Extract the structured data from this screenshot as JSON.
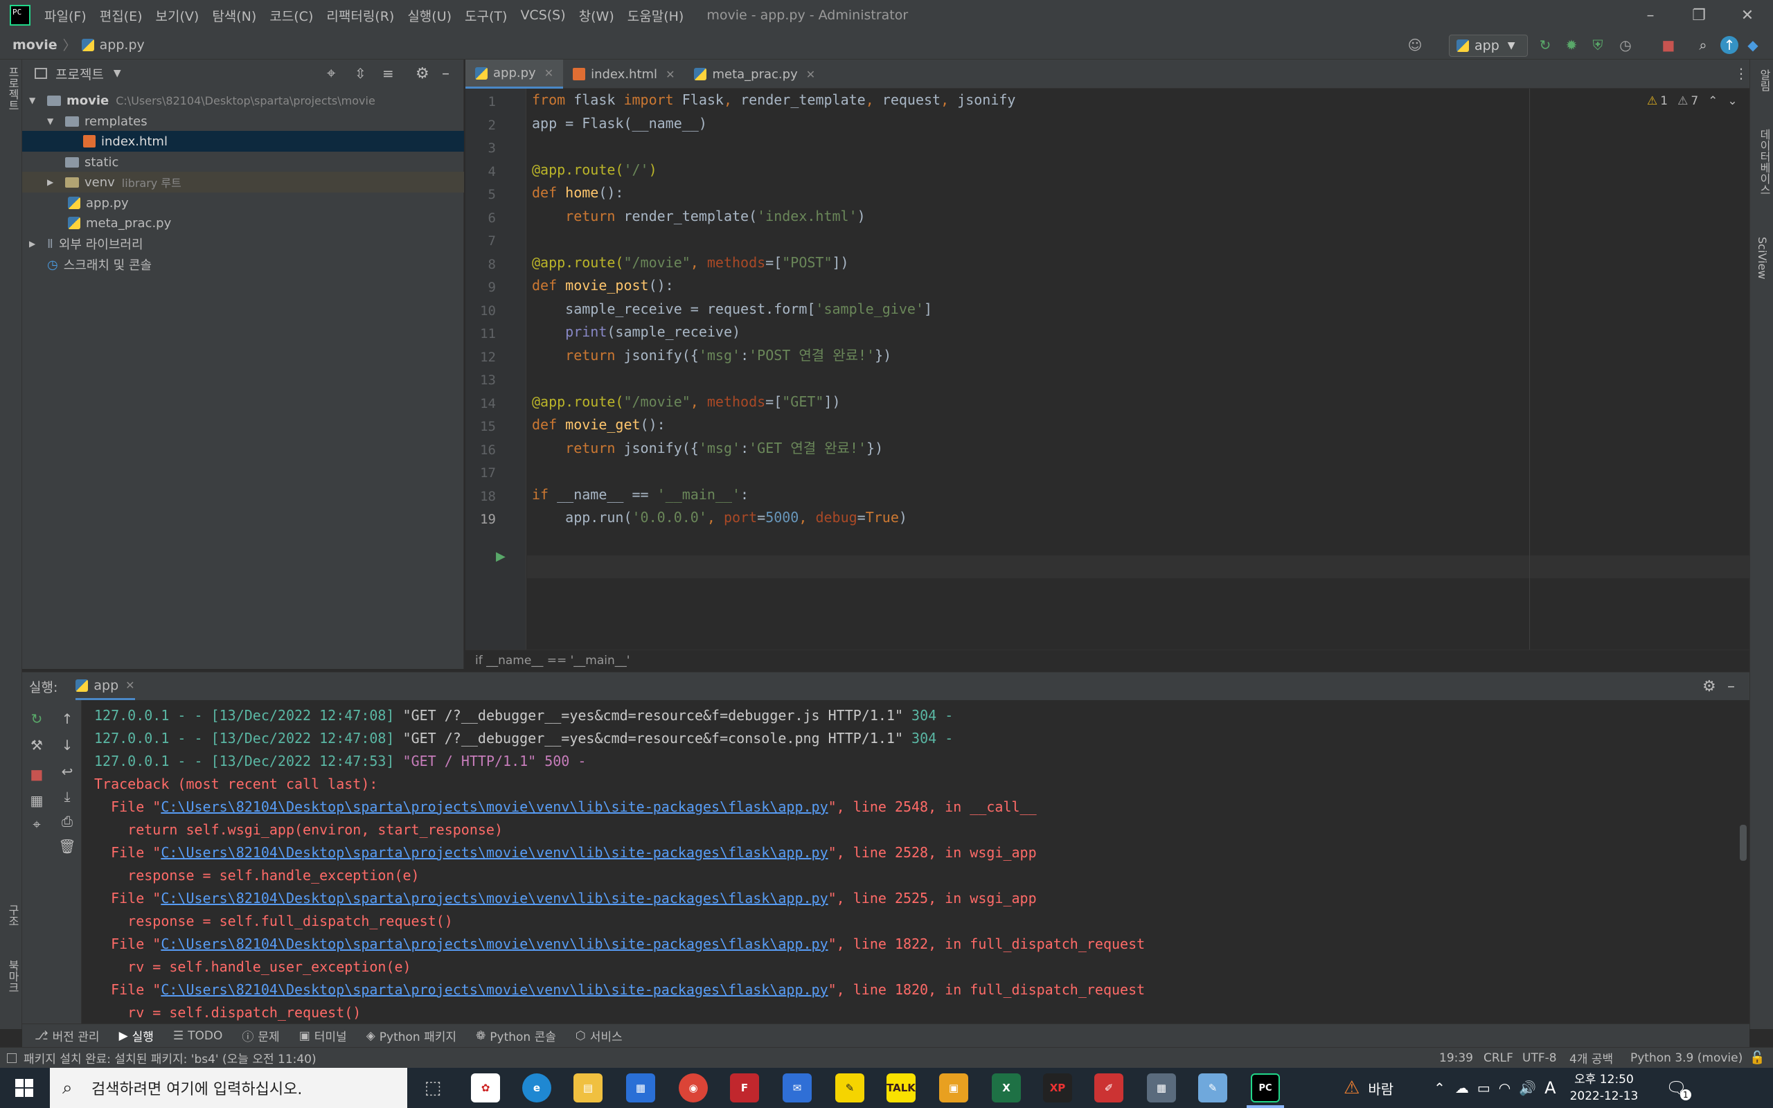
{
  "menubar": {
    "items": [
      "파일(F)",
      "편집(E)",
      "보기(V)",
      "탐색(N)",
      "코드(C)",
      "리팩터링(R)",
      "실행(U)",
      "도구(T)",
      "VCS(S)",
      "창(W)",
      "도움말(H)"
    ],
    "window_title": "movie - app.py - Administrator"
  },
  "navbar": {
    "project": "movie",
    "file": "app.py",
    "run_config": "app"
  },
  "project": {
    "header": "프로젝트",
    "root_name": "movie",
    "root_path": "C:\\Users\\82104\\Desktop\\sparta\\projects\\movie",
    "templates": "remplates",
    "index": "index.html",
    "static": "static",
    "venv": "venv",
    "venv_note": "library 루트",
    "app": "app.py",
    "meta": "meta_prac.py",
    "ext_libs": "외부 라이브러리",
    "scratch": "스크래치 및 콘솔"
  },
  "tabs": [
    {
      "label": "app.py"
    },
    {
      "label": "index.html"
    },
    {
      "label": "meta_prac.py"
    }
  ],
  "inspections": {
    "warn": "1",
    "weak": "7"
  },
  "code": [
    [
      [
        "kw",
        "from "
      ],
      [
        "",
        "flask "
      ],
      [
        "kw",
        "import "
      ],
      [
        "",
        "Flask"
      ],
      [
        "kw",
        ", "
      ],
      [
        "",
        "render_template"
      ],
      [
        "kw",
        ", "
      ],
      [
        "",
        "request"
      ],
      [
        "kw",
        ", "
      ],
      [
        "",
        "jsonify"
      ]
    ],
    [
      [
        "",
        "app = Flask(__name__)"
      ]
    ],
    [],
    [
      [
        "dec",
        "@app.route("
      ],
      [
        "str",
        "'/'"
      ],
      [
        "dec",
        ")"
      ]
    ],
    [
      [
        "kw",
        "def "
      ],
      [
        "fn",
        "home"
      ],
      [
        "",
        "():"
      ]
    ],
    [
      [
        "",
        "    "
      ],
      [
        "kw",
        "return "
      ],
      [
        "",
        "render_template("
      ],
      [
        "str",
        "'index.html'"
      ],
      [
        "",
        ")"
      ]
    ],
    [],
    [
      [
        "dec",
        "@app.route("
      ],
      [
        "str",
        "\"/movie\""
      ],
      [
        "kw",
        ", "
      ],
      [
        "pm",
        "methods"
      ],
      [
        "",
        "=["
      ],
      [
        "str",
        "\"POST\""
      ],
      [
        "",
        "])"
      ]
    ],
    [
      [
        "kw",
        "def "
      ],
      [
        "fn",
        "movie_post"
      ],
      [
        "",
        "():"
      ]
    ],
    [
      [
        "",
        "    sample_receive = request.form["
      ],
      [
        "str",
        "'sample_give'"
      ],
      [
        "",
        "]"
      ]
    ],
    [
      [
        "",
        "    "
      ],
      [
        "bi",
        "print"
      ],
      [
        "",
        "(sample_receive)"
      ]
    ],
    [
      [
        "",
        "    "
      ],
      [
        "kw",
        "return "
      ],
      [
        "",
        "jsonify({"
      ],
      [
        "str",
        "'msg'"
      ],
      [
        "",
        ":"
      ],
      [
        "str",
        "'POST 연결 완료!'"
      ],
      [
        "",
        "})"
      ]
    ],
    [],
    [
      [
        "dec",
        "@app.route("
      ],
      [
        "str",
        "\"/movie\""
      ],
      [
        "kw",
        ", "
      ],
      [
        "pm",
        "methods"
      ],
      [
        "",
        "=["
      ],
      [
        "str",
        "\"GET\""
      ],
      [
        "",
        "])"
      ]
    ],
    [
      [
        "kw",
        "def "
      ],
      [
        "fn",
        "movie_get"
      ],
      [
        "",
        "():"
      ]
    ],
    [
      [
        "",
        "    "
      ],
      [
        "kw",
        "return "
      ],
      [
        "",
        "jsonify({"
      ],
      [
        "str",
        "'msg'"
      ],
      [
        "",
        ":"
      ],
      [
        "str",
        "'GET 연결 완료!'"
      ],
      [
        "",
        "})"
      ]
    ],
    [],
    [
      [
        "kw",
        "if "
      ],
      [
        "",
        "__name__ == "
      ],
      [
        "str",
        "'__main__'"
      ],
      [
        "",
        ":"
      ]
    ],
    [
      [
        "",
        "    app.run("
      ],
      [
        "str",
        "'0.0.0.0'"
      ],
      [
        "kw",
        ", "
      ],
      [
        "pm",
        "port"
      ],
      [
        "",
        "="
      ],
      [
        "num",
        "5000"
      ],
      [
        "kw",
        ", "
      ],
      [
        "pm",
        "debug"
      ],
      [
        "",
        "="
      ],
      [
        "kw",
        "True"
      ],
      [
        "",
        ")"
      ]
    ]
  ],
  "editor_breadcrumb": "if __name__ == '__main__'",
  "run": {
    "label": "실행:",
    "tab": "app"
  },
  "console": [
    [
      [
        "grn",
        "127.0.0.1 - - [13/Dec/2022 12:47:08] "
      ],
      [
        "yel",
        "\"GET /?__debugger__=yes&cmd=resource&f=debugger.js HTTP/1.1\""
      ],
      [
        "grn",
        " 304 -"
      ]
    ],
    [
      [
        "grn",
        "127.0.0.1 - - [13/Dec/2022 12:47:08] "
      ],
      [
        "yel",
        "\"GET /?__debugger__=yes&cmd=resource&f=console.png HTTP/1.1\""
      ],
      [
        "grn",
        " 304 -"
      ]
    ],
    [
      [
        "grn",
        "127.0.0.1 - - [13/Dec/2022 12:47:53] "
      ],
      [
        "mag",
        "\"GET / HTTP/1.1\""
      ],
      [
        "mag",
        " 500 -"
      ]
    ],
    [
      [
        "err",
        "Traceback (most recent call last):"
      ]
    ],
    [
      [
        "err",
        "  File \""
      ],
      [
        "lnk",
        "C:\\Users\\82104\\Desktop\\sparta\\projects\\movie\\venv\\lib\\site-packages\\flask\\app.py"
      ],
      [
        "err",
        "\", line 2548, in __call__"
      ]
    ],
    [
      [
        "err",
        "    return self.wsgi_app(environ, start_response)"
      ]
    ],
    [
      [
        "err",
        "  File \""
      ],
      [
        "lnk",
        "C:\\Users\\82104\\Desktop\\sparta\\projects\\movie\\venv\\lib\\site-packages\\flask\\app.py"
      ],
      [
        "err",
        "\", line 2528, in wsgi_app"
      ]
    ],
    [
      [
        "err",
        "    response = self.handle_exception(e)"
      ]
    ],
    [
      [
        "err",
        "  File \""
      ],
      [
        "lnk",
        "C:\\Users\\82104\\Desktop\\sparta\\projects\\movie\\venv\\lib\\site-packages\\flask\\app.py"
      ],
      [
        "err",
        "\", line 2525, in wsgi_app"
      ]
    ],
    [
      [
        "err",
        "    response = self.full_dispatch_request()"
      ]
    ],
    [
      [
        "err",
        "  File \""
      ],
      [
        "lnk",
        "C:\\Users\\82104\\Desktop\\sparta\\projects\\movie\\venv\\lib\\site-packages\\flask\\app.py"
      ],
      [
        "err",
        "\", line 1822, in full_dispatch_request"
      ]
    ],
    [
      [
        "err",
        "    rv = self.handle_user_exception(e)"
      ]
    ],
    [
      [
        "err",
        "  File \""
      ],
      [
        "lnk",
        "C:\\Users\\82104\\Desktop\\sparta\\projects\\movie\\venv\\lib\\site-packages\\flask\\app.py"
      ],
      [
        "err",
        "\", line 1820, in full_dispatch_request"
      ]
    ],
    [
      [
        "err",
        "    rv = self.dispatch_request()"
      ]
    ]
  ],
  "bottom_tabs": [
    {
      "icon": "branch-icon",
      "label": "버전 관리"
    },
    {
      "icon": "run-icon",
      "label": "실행"
    },
    {
      "icon": "list-icon",
      "label": "TODO"
    },
    {
      "icon": "info-icon",
      "label": "문제"
    },
    {
      "icon": "terminal-icon",
      "label": "터미널"
    },
    {
      "icon": "layers-icon",
      "label": "Python 패키지"
    },
    {
      "icon": "python-console-icon",
      "label": "Python 콘솔"
    },
    {
      "icon": "services-icon",
      "label": "서비스"
    }
  ],
  "status": {
    "message": "패키지 설치 완료: 설치된 패키지: 'bs4' (오늘 오전 11:40)",
    "position": "19:39",
    "eol": "CRLF",
    "encoding": "UTF-8",
    "indent": "4개 공백",
    "interpreter": "Python 3.9 (movie)"
  },
  "side_labels": {
    "left_top": "프로젝트",
    "left_mid": "구조",
    "left_bottom": "북마크",
    "right_top": "알림",
    "right_mid": "데이터베이스",
    "right_sci": "SciView"
  },
  "taskbar": {
    "search_placeholder": "검색하려면 여기에 입력하십시오.",
    "weather": "바람",
    "time": "오후 12:50",
    "date": "2022-12-13",
    "ime": "A",
    "notif": "1"
  }
}
